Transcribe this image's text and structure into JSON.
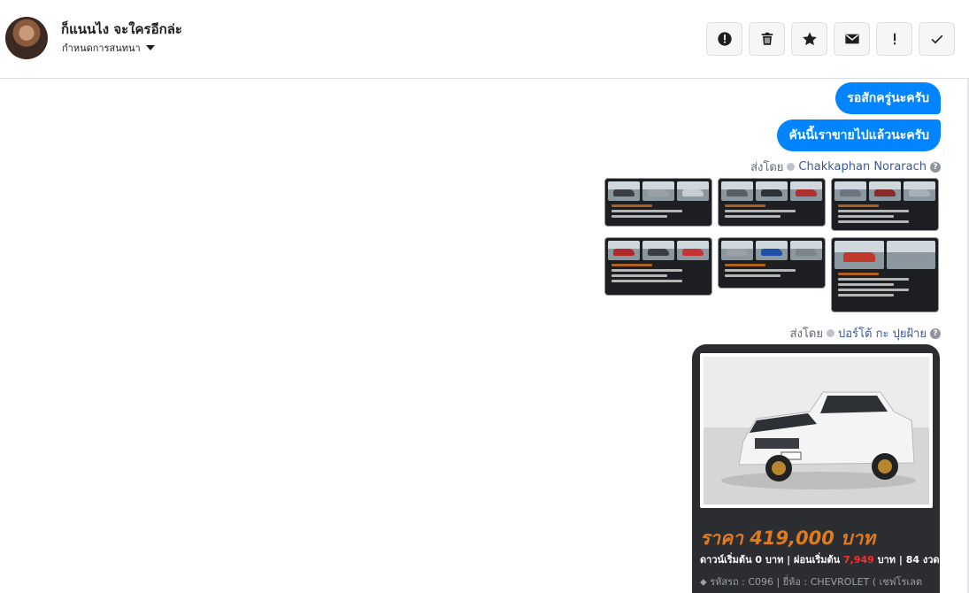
{
  "header": {
    "contact_name": "ก็แนนไง จะใครอีกล่ะ",
    "assign_label": "กำหนดการสนทนา",
    "actions": [
      {
        "id": "spam",
        "icon": "alert-circle-icon"
      },
      {
        "id": "delete",
        "icon": "trash-icon"
      },
      {
        "id": "star",
        "icon": "star-icon"
      },
      {
        "id": "unread",
        "icon": "envelope-icon"
      },
      {
        "id": "important",
        "icon": "exclamation-icon"
      },
      {
        "id": "done",
        "icon": "check-icon"
      }
    ]
  },
  "messages": [
    {
      "text": "รอสักครู่นะครับ"
    },
    {
      "text": "คันนี้เราขายไปแล้วนะครับ"
    }
  ],
  "senders": [
    {
      "prefix": "ส่งโดย",
      "name": "Chakkaphan Norarach"
    },
    {
      "prefix": "ส่งโดย",
      "name": "ปอร์โต้ กะ ปุยฝ้าย"
    }
  ],
  "listing_card": {
    "price": "ราคา 419,000 บาท",
    "terms_a": "ดาวน์เริ่มต้น 0 บาท | ผ่อนเริ่มต้น ",
    "terms_installment": "7,949",
    "terms_b": " บาท | 84 งวด",
    "meta": "รหัสรถ : C096 | ยี่ห้อ : CHEVROLET ( เชฟโรเลต"
  },
  "colors": {
    "bubble": "#0084ff",
    "price": "#e07a1f",
    "installment": "#ff2d2d",
    "sender_name": "#385898"
  }
}
